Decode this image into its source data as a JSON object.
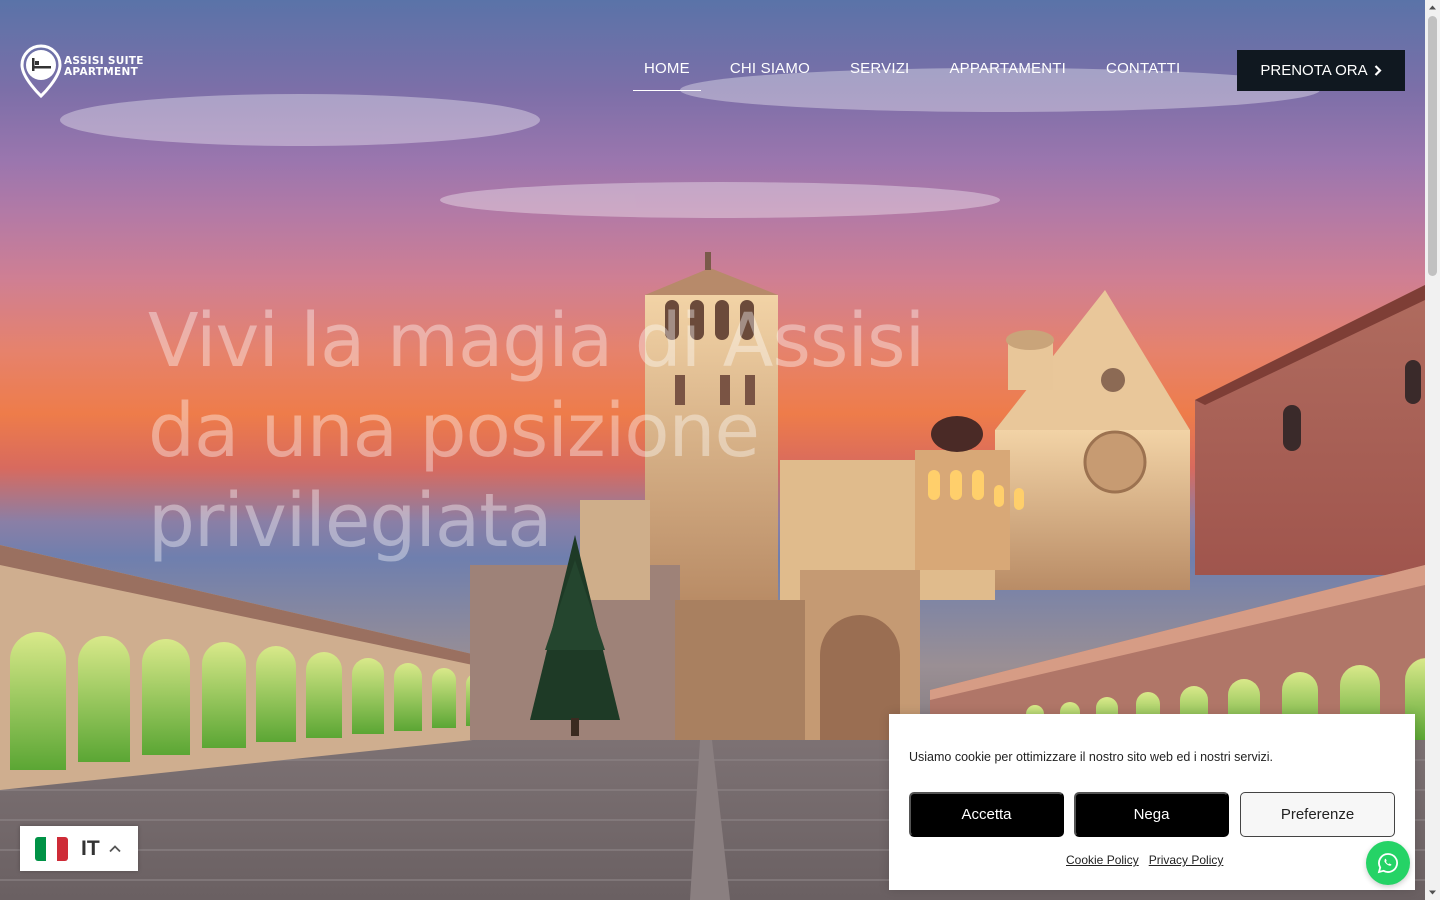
{
  "header": {
    "brand": {
      "line1": "ASSISI SUITE",
      "line2": "APARTMENT"
    },
    "nav": [
      {
        "label": "HOME",
        "active": true
      },
      {
        "label": "CHI SIAMO",
        "active": false
      },
      {
        "label": "SERVIZI",
        "active": false
      },
      {
        "label": "APPARTAMENTI",
        "active": false
      },
      {
        "label": "CONTATTI",
        "active": false
      }
    ],
    "cta_label": "PRENOTA ORA"
  },
  "hero": {
    "headline_lines": [
      "Vivi la magia di Assisi",
      "da una posizione",
      "privilegiata"
    ]
  },
  "language": {
    "code": "IT",
    "flag_colors": [
      "#009246",
      "#ffffff",
      "#ce2b37"
    ]
  },
  "cookie_banner": {
    "message": "Usiamo cookie per ottimizzare il nostro sito web ed i nostri servizi.",
    "accept_label": "Accetta",
    "deny_label": "Nega",
    "preferences_label": "Preferenze",
    "links": [
      "Cookie Policy",
      "Privacy Policy"
    ]
  },
  "colors": {
    "cta_bg": "#101820",
    "whatsapp": "#25d366"
  }
}
